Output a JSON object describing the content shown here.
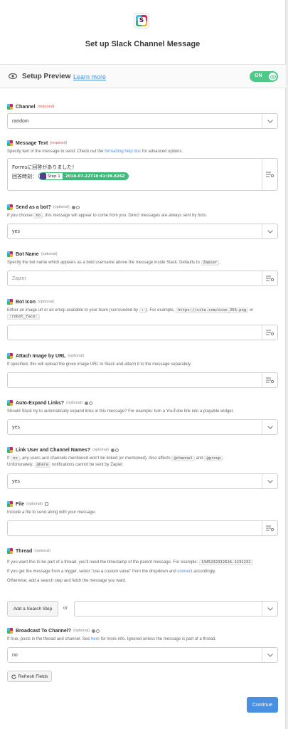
{
  "header": {
    "logo_letter": "S",
    "title": "Set up Slack Channel Message"
  },
  "setup": {
    "label": "Setup Preview",
    "learn_more": "Learn more",
    "toggle": "ON"
  },
  "fields": {
    "channel": {
      "label": "Channel",
      "req": "(required)",
      "value": "random"
    },
    "message": {
      "label": "Message Text",
      "req": "(required)",
      "desc_pre": "Specify text of the message to send. Check out the ",
      "desc_link": "formatting help doc",
      "desc_post": " for advanced options.",
      "line1": "Formsに回答がありました！",
      "line2_prefix": "回答時刻：",
      "pill_step": "Step 1",
      "pill_value": "2018-07-22T18:41:39.826Z"
    },
    "as_bot": {
      "label": "Send as a bot?",
      "opt": "(optional)",
      "desc_pre": "If you choose ",
      "code": "no",
      "desc_post": ", this message will appear to come from you. Direct messages are always sent by bots.",
      "value": "yes"
    },
    "bot_name": {
      "label": "Bot Name",
      "opt": "(optional)",
      "desc_pre": "Specify the bot name which appears as a bold username above the message inside Slack. Defaults to ",
      "code": "Zapier",
      "desc_post": ".",
      "placeholder": "Zapier"
    },
    "bot_icon": {
      "label": "Bot Icon",
      "opt": "(optional)",
      "desc_pre": "Either an image url or an emoji available to your team (surrounded by ",
      "code1": ":",
      "desc_mid": "). For example, ",
      "code2": "https://site.com/icon_256.png",
      "desc_or": " or ",
      "code3": ":robot_face:"
    },
    "attach_image": {
      "label": "Attach Image by URL",
      "opt": "(optional)",
      "desc": "If specified, this will upload the given image URL to Slack and attach it to the message separately."
    },
    "auto_expand": {
      "label": "Auto-Expand Links?",
      "opt": "(optional)",
      "desc": "Should Slack try to automatically expand links in this message? For example: turn a YouTube link into a playable widget.",
      "value": "yes"
    },
    "link_names": {
      "label": "Link User and Channel Names?",
      "opt": "(optional)",
      "desc_pre": "If ",
      "code1": "no",
      "desc_mid": ", any users and channels mentioned won't be linked (or mentioned). Also affects ",
      "code2": "@channel",
      "desc_and": " and ",
      "code3": "@group",
      "desc_post": ".",
      "desc2_pre": "Unfortunately, ",
      "code4": "@here",
      "desc2_post": " notifications cannot be sent by Zapier.",
      "value": "yes"
    },
    "file": {
      "label": "File",
      "opt": "(optional)",
      "desc": "Include a file to send along with your message."
    },
    "thread": {
      "label": "Thread",
      "opt": "(optional)",
      "desc1_pre": "If you want this to be part of a thread, you'll need the timestamp of the parent message. For example: ",
      "code": "1345232312616.1231232",
      "desc2_pre": "If you get the message from a trigger, select \"use a custom value\" from the dropdown and ",
      "desc2_link": "connect",
      "desc2_post": " accordingly.",
      "desc3": "Otherwise, add a search step and fetch the message you want.",
      "search_btn": "Add a Search Step",
      "or": "or"
    },
    "broadcast": {
      "label": "Broadcast To Channel?",
      "opt": "(optional)",
      "desc_pre": "If true, posts in the thread and channel. See ",
      "desc_link": "here",
      "desc_post": " for more info. Ignored unless the message is part of a thread.",
      "value": "no"
    }
  },
  "footer": {
    "refresh": "Refresh Fields",
    "continue": "Continue"
  },
  "colors": {
    "accent": "#4a90e2",
    "toggle_on": "#4fc98a",
    "required": "#d9534f",
    "link": "#4a90d9"
  }
}
